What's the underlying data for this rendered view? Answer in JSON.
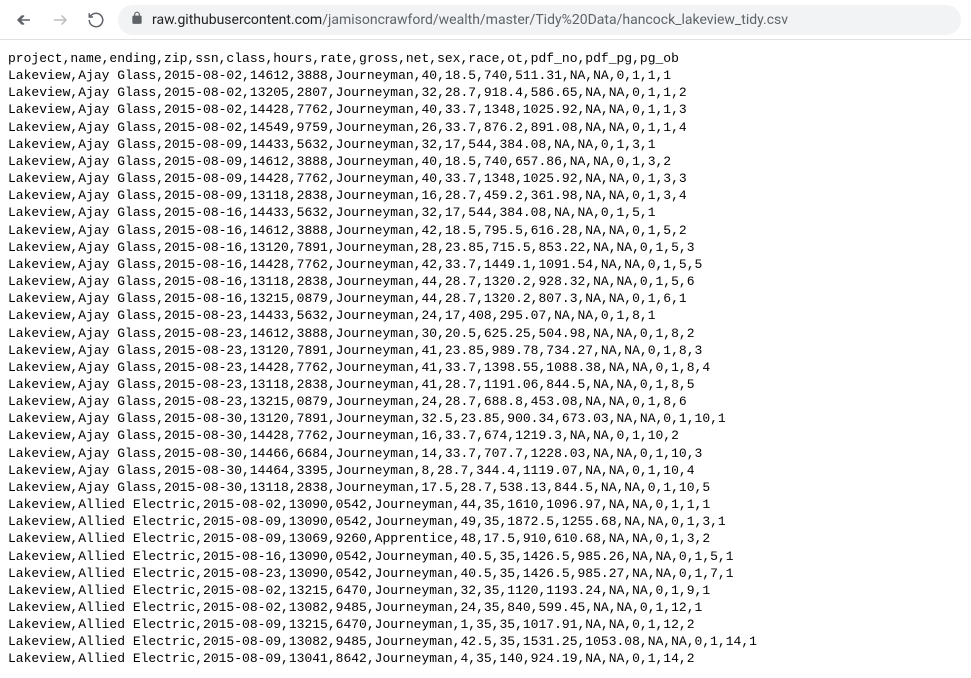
{
  "url": {
    "host": "raw.githubusercontent.com",
    "path": "/jamisoncrawford/wealth/master/Tidy%20Data/hancock_lakeview_tidy.csv"
  },
  "csv": {
    "header": "project,name,ending,zip,ssn,class,hours,rate,gross,net,sex,race,ot,pdf_no,pdf_pg,pg_ob",
    "rows": [
      "Lakeview,Ajay Glass,2015-08-02,14612,3888,Journeyman,40,18.5,740,511.31,NA,NA,0,1,1,1",
      "Lakeview,Ajay Glass,2015-08-02,13205,2807,Journeyman,32,28.7,918.4,586.65,NA,NA,0,1,1,2",
      "Lakeview,Ajay Glass,2015-08-02,14428,7762,Journeyman,40,33.7,1348,1025.92,NA,NA,0,1,1,3",
      "Lakeview,Ajay Glass,2015-08-02,14549,9759,Journeyman,26,33.7,876.2,891.08,NA,NA,0,1,1,4",
      "Lakeview,Ajay Glass,2015-08-09,14433,5632,Journeyman,32,17,544,384.08,NA,NA,0,1,3,1",
      "Lakeview,Ajay Glass,2015-08-09,14612,3888,Journeyman,40,18.5,740,657.86,NA,NA,0,1,3,2",
      "Lakeview,Ajay Glass,2015-08-09,14428,7762,Journeyman,40,33.7,1348,1025.92,NA,NA,0,1,3,3",
      "Lakeview,Ajay Glass,2015-08-09,13118,2838,Journeyman,16,28.7,459.2,361.98,NA,NA,0,1,3,4",
      "Lakeview,Ajay Glass,2015-08-16,14433,5632,Journeyman,32,17,544,384.08,NA,NA,0,1,5,1",
      "Lakeview,Ajay Glass,2015-08-16,14612,3888,Journeyman,42,18.5,795.5,616.28,NA,NA,0,1,5,2",
      "Lakeview,Ajay Glass,2015-08-16,13120,7891,Journeyman,28,23.85,715.5,853.22,NA,NA,0,1,5,3",
      "Lakeview,Ajay Glass,2015-08-16,14428,7762,Journeyman,42,33.7,1449.1,1091.54,NA,NA,0,1,5,5",
      "Lakeview,Ajay Glass,2015-08-16,13118,2838,Journeyman,44,28.7,1320.2,928.32,NA,NA,0,1,5,6",
      "Lakeview,Ajay Glass,2015-08-16,13215,0879,Journeyman,44,28.7,1320.2,807.3,NA,NA,0,1,6,1",
      "Lakeview,Ajay Glass,2015-08-23,14433,5632,Journeyman,24,17,408,295.07,NA,NA,0,1,8,1",
      "Lakeview,Ajay Glass,2015-08-23,14612,3888,Journeyman,30,20.5,625.25,504.98,NA,NA,0,1,8,2",
      "Lakeview,Ajay Glass,2015-08-23,13120,7891,Journeyman,41,23.85,989.78,734.27,NA,NA,0,1,8,3",
      "Lakeview,Ajay Glass,2015-08-23,14428,7762,Journeyman,41,33.7,1398.55,1088.38,NA,NA,0,1,8,4",
      "Lakeview,Ajay Glass,2015-08-23,13118,2838,Journeyman,41,28.7,1191.06,844.5,NA,NA,0,1,8,5",
      "Lakeview,Ajay Glass,2015-08-23,13215,0879,Journeyman,24,28.7,688.8,453.08,NA,NA,0,1,8,6",
      "Lakeview,Ajay Glass,2015-08-30,13120,7891,Journeyman,32.5,23.85,900.34,673.03,NA,NA,0,1,10,1",
      "Lakeview,Ajay Glass,2015-08-30,14428,7762,Journeyman,16,33.7,674,1219.3,NA,NA,0,1,10,2",
      "Lakeview,Ajay Glass,2015-08-30,14466,6684,Journeyman,14,33.7,707.7,1228.03,NA,NA,0,1,10,3",
      "Lakeview,Ajay Glass,2015-08-30,14464,3395,Journeyman,8,28.7,344.4,1119.07,NA,NA,0,1,10,4",
      "Lakeview,Ajay Glass,2015-08-30,13118,2838,Journeyman,17.5,28.7,538.13,844.5,NA,NA,0,1,10,5",
      "Lakeview,Allied Electric,2015-08-02,13090,0542,Journeyman,44,35,1610,1096.97,NA,NA,0,1,1,1",
      "Lakeview,Allied Electric,2015-08-09,13090,0542,Journeyman,49,35,1872.5,1255.68,NA,NA,0,1,3,1",
      "Lakeview,Allied Electric,2015-08-09,13069,9260,Apprentice,48,17.5,910,610.68,NA,NA,0,1,3,2",
      "Lakeview,Allied Electric,2015-08-16,13090,0542,Journeyman,40.5,35,1426.5,985.26,NA,NA,0,1,5,1",
      "Lakeview,Allied Electric,2015-08-23,13090,0542,Journeyman,40.5,35,1426.5,985.27,NA,NA,0,1,7,1",
      "Lakeview,Allied Electric,2015-08-02,13215,6470,Journeyman,32,35,1120,1193.24,NA,NA,0,1,9,1",
      "Lakeview,Allied Electric,2015-08-02,13082,9485,Journeyman,24,35,840,599.45,NA,NA,0,1,12,1",
      "Lakeview,Allied Electric,2015-08-09,13215,6470,Journeyman,1,35,35,1017.91,NA,NA,0,1,12,2",
      "Lakeview,Allied Electric,2015-08-09,13082,9485,Journeyman,42.5,35,1531.25,1053.08,NA,NA,0,1,14,1",
      "Lakeview,Allied Electric,2015-08-09,13041,8642,Journeyman,4,35,140,924.19,NA,NA,0,1,14,2"
    ]
  }
}
